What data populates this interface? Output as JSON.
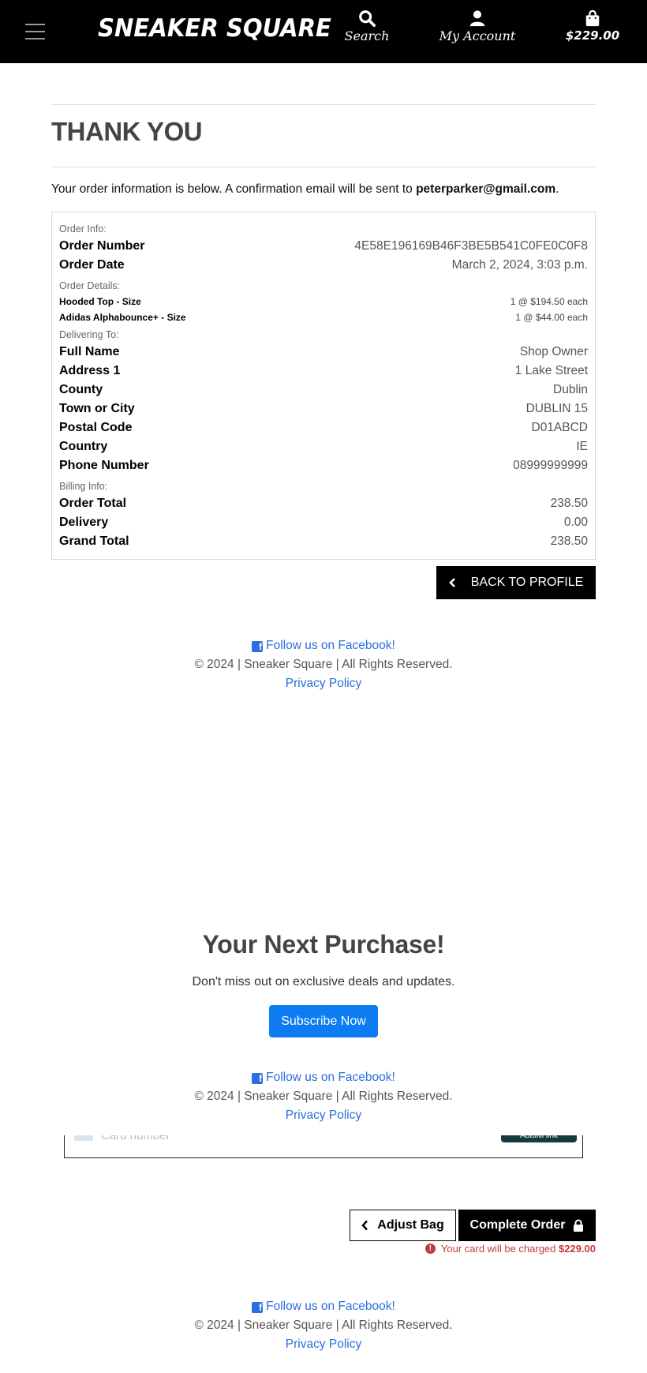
{
  "header": {
    "brand": "SNEAKER SQUARE",
    "search_label": "Search",
    "account_label": "My Account",
    "bag_total": "$229.00"
  },
  "thankyou": {
    "title": "THANK YOU",
    "intro_text": "Your order information is below. A confirmation email will be sent to ",
    "email": "peterparker@gmail.com",
    "intro_end": "."
  },
  "order": {
    "order_info_heading": "Order Info:",
    "order_number_label": "Order Number",
    "order_number": "4E58E196169B46F3BE5B541C0FE0C0F8",
    "order_date_label": "Order Date",
    "order_date": "March 2, 2024, 3:03 p.m.",
    "details_heading": "Order Details:",
    "items": [
      {
        "name": "Hooded Top - Size",
        "qty": "1 @ $194.50 each"
      },
      {
        "name": "Adidas Alphabounce+ - Size",
        "qty": "1 @ $44.00 each"
      }
    ],
    "delivering_heading": "Delivering To:",
    "delivery": [
      {
        "label": "Full Name",
        "value": "Shop Owner"
      },
      {
        "label": "Address 1",
        "value": "1 Lake Street"
      },
      {
        "label": "County",
        "value": "Dublin"
      },
      {
        "label": "Town or City",
        "value": "DUBLIN 15"
      },
      {
        "label": "Postal Code",
        "value": "D01ABCD"
      },
      {
        "label": "Country",
        "value": "IE"
      },
      {
        "label": "Phone Number",
        "value": "08999999999"
      }
    ],
    "billing_heading": "Billing Info:",
    "billing": [
      {
        "label": "Order Total",
        "value": "238.50"
      },
      {
        "label": "Delivery",
        "value": "0.00"
      },
      {
        "label": "Grand Total",
        "value": "238.50"
      }
    ]
  },
  "back_button": "BACK TO PROFILE",
  "footer": {
    "facebook": "Follow us on Facebook!",
    "copyright": "© 2024 | Sneaker Square | All Rights Reserved.",
    "privacy": "Privacy Policy"
  },
  "promo": {
    "title": "Your Next Purchase!",
    "subtitle": "Don't miss out on exclusive deals and updates.",
    "subscribe": "Subscribe Now"
  },
  "checkout": {
    "card_placeholder": "Card number",
    "autofill": "Autofill link",
    "adjust_bag": "Adjust Bag",
    "complete_order": "Complete Order",
    "charge_text": "Your card will be charged ",
    "charge_amount": "$229.00"
  },
  "colors": {
    "header_bg": "#000000",
    "link": "#2a6fdb",
    "subscribe": "#0d7cf2",
    "alert": "#c43a3a"
  }
}
